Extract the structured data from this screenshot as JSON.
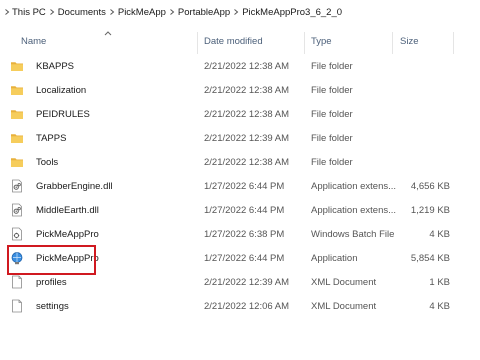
{
  "breadcrumb": [
    "This PC",
    "Documents",
    "PickMeApp",
    "PortableApp",
    "PickMeAppPro3_6_2_0"
  ],
  "columns": {
    "name": "Name",
    "date": "Date modified",
    "type": "Type",
    "size": "Size"
  },
  "files": [
    {
      "name": "KBAPPS",
      "date": "2/21/2022 12:38 AM",
      "type": "File folder",
      "size": "",
      "icon": "folder-icon"
    },
    {
      "name": "Localization",
      "date": "2/21/2022 12:38 AM",
      "type": "File folder",
      "size": "",
      "icon": "folder-icon"
    },
    {
      "name": "PEIDRULES",
      "date": "2/21/2022 12:38 AM",
      "type": "File folder",
      "size": "",
      "icon": "folder-icon"
    },
    {
      "name": "TAPPS",
      "date": "2/21/2022 12:39 AM",
      "type": "File folder",
      "size": "",
      "icon": "folder-icon"
    },
    {
      "name": "Tools",
      "date": "2/21/2022 12:38 AM",
      "type": "File folder",
      "size": "",
      "icon": "folder-icon"
    },
    {
      "name": "GrabberEngine.dll",
      "date": "1/27/2022 6:44 PM",
      "type": "Application extens...",
      "size": "4,656 KB",
      "icon": "dll-icon"
    },
    {
      "name": "MiddleEarth.dll",
      "date": "1/27/2022 6:44 PM",
      "type": "Application extens...",
      "size": "1,219 KB",
      "icon": "dll-icon"
    },
    {
      "name": "PickMeAppPro",
      "date": "1/27/2022 6:38 PM",
      "type": "Windows Batch File",
      "size": "4 KB",
      "icon": "batch-file-icon"
    },
    {
      "name": "PickMeAppPro",
      "date": "1/27/2022 6:44 PM",
      "type": "Application",
      "size": "5,854 KB",
      "icon": "application-icon"
    },
    {
      "name": "profiles",
      "date": "2/21/2022 12:39 AM",
      "type": "XML Document",
      "size": "1 KB",
      "icon": "document-icon"
    },
    {
      "name": "settings",
      "date": "2/21/2022 12:06 AM",
      "type": "XML Document",
      "size": "4 KB",
      "icon": "document-icon"
    }
  ],
  "colors": {
    "highlight_border": "#d01920",
    "folder": "#f3c24c",
    "header_text": "#4c607a"
  }
}
